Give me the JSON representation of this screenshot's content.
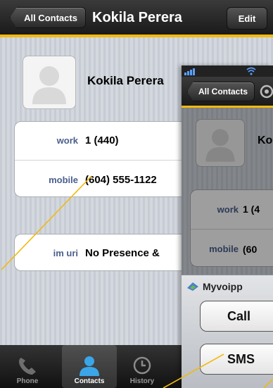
{
  "nav": {
    "back_label": "All Contacts",
    "title": "Kokila Perera",
    "edit_label": "Edit"
  },
  "contact": {
    "name": "Kokila Perera",
    "rows": [
      {
        "label": "work",
        "value": "1 (440)"
      },
      {
        "label": "mobile",
        "value": "(604) 555-1122"
      }
    ],
    "im": {
      "label": "im uri",
      "value": "No Presence &"
    }
  },
  "tabs": [
    {
      "label": "Phone",
      "icon": "phone-icon",
      "active": false
    },
    {
      "label": "Contacts",
      "icon": "contacts-icon",
      "active": true
    },
    {
      "label": "History",
      "icon": "clock-icon",
      "active": false
    }
  ],
  "overlay": {
    "back_label": "All Contacts",
    "contact_name": "Ko",
    "rows": [
      {
        "label": "work",
        "value": "1 (4"
      },
      {
        "label": "mobile",
        "value": "(60"
      }
    ],
    "sheet_title": "Myvoipp",
    "call_label": "Call",
    "sms_label": "SMS"
  },
  "colors": {
    "accent_bar": "#f2b90f",
    "callout_line": "#f2b90f",
    "label_blue": "#4a5f8d"
  }
}
